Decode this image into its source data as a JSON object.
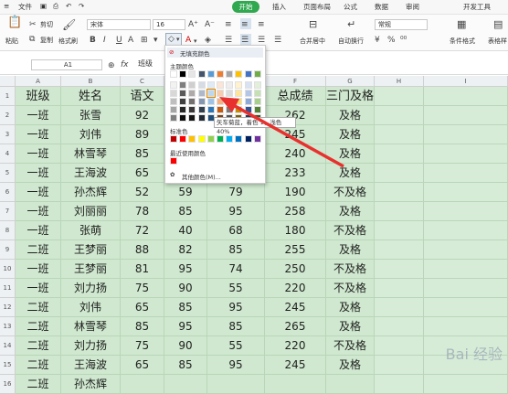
{
  "menubar": {
    "file": "文件",
    "tabs": [
      "开始",
      "插入",
      "页面布局",
      "公式",
      "数据",
      "审阅",
      "开发工具"
    ]
  },
  "ribbon": {
    "cut": "剪切",
    "copy": "复制",
    "paste": "粘贴",
    "format_painter": "格式刷",
    "font_name": "宋体",
    "font_size": "16",
    "merge_center": "合并居中",
    "wrap_text": "自动换行",
    "number_format": "常规",
    "conditional_format": "条件格式",
    "table_style": "表格样"
  },
  "formula_bar": {
    "cell_ref": "A1",
    "fx": "fx",
    "content": "班级"
  },
  "columns": [
    "A",
    "B",
    "C",
    "D",
    "E",
    "F",
    "G",
    "H",
    "I"
  ],
  "rows": [
    [
      "班级",
      "姓名",
      "语文",
      "数学",
      "英语",
      "总成绩",
      "三门及格"
    ],
    [
      "一班",
      "张雪",
      "92",
      "",
      "",
      "262",
      "及格"
    ],
    [
      "一班",
      "刘伟",
      "89",
      "",
      "",
      "245",
      "及格"
    ],
    [
      "一班",
      "林雪琴",
      "85",
      "",
      "",
      "240",
      "及格"
    ],
    [
      "一班",
      "王海波",
      "65",
      "",
      "",
      "233",
      "及格"
    ],
    [
      "一班",
      "孙杰辉",
      "52",
      "59",
      "79",
      "190",
      "不及格"
    ],
    [
      "一班",
      "刘丽丽",
      "78",
      "85",
      "95",
      "258",
      "及格"
    ],
    [
      "一班",
      "张萌",
      "72",
      "40",
      "68",
      "180",
      "不及格"
    ],
    [
      "二班",
      "王梦丽",
      "88",
      "82",
      "85",
      "255",
      "及格"
    ],
    [
      "一班",
      "王梦丽",
      "81",
      "95",
      "74",
      "250",
      "不及格"
    ],
    [
      "一班",
      "刘力扬",
      "75",
      "90",
      "55",
      "220",
      "不及格"
    ],
    [
      "二班",
      "刘伟",
      "65",
      "85",
      "95",
      "245",
      "及格"
    ],
    [
      "二班",
      "林雪琴",
      "85",
      "95",
      "85",
      "265",
      "及格"
    ],
    [
      "二班",
      "刘力扬",
      "75",
      "90",
      "55",
      "220",
      "不及格"
    ],
    [
      "二班",
      "王海波",
      "65",
      "85",
      "95",
      "245",
      "及格"
    ],
    [
      "二班",
      "孙杰辉",
      "",
      "",
      "",
      "",
      ""
    ]
  ],
  "row_numbers": [
    "1",
    "2",
    "3",
    "4",
    "5",
    "6",
    "7",
    "8",
    "9",
    "10",
    "11",
    "12",
    "13",
    "14",
    "15",
    "16"
  ],
  "palette": {
    "no_fill": "无填充颜色",
    "theme_colors": "主题颜色",
    "standard_colors": "标准色",
    "recent_colors": "最近使用颜色",
    "more_colors": "其他颜色(M)...",
    "tooltip": "矢车菊蓝，着色 1，浅色 40%",
    "theme_rows": [
      [
        "#ffffff",
        "#000000",
        "#e7e6e6",
        "#44546a",
        "#5b9bd5",
        "#ed7d31",
        "#a5a5a5",
        "#ffc000",
        "#4472c4",
        "#70ad47"
      ],
      [
        "#f2f2f2",
        "#7f7f7f",
        "#d0cece",
        "#d6dce4",
        "#deebf6",
        "#fbe5d5",
        "#ededed",
        "#fff2cc",
        "#d9e2f3",
        "#e2efd9"
      ],
      [
        "#d8d8d8",
        "#595959",
        "#aeaaaa",
        "#adb9ca",
        "#bdd7ee",
        "#f7cbac",
        "#dbdbdb",
        "#fee599",
        "#b4c6e7",
        "#c5e0b3"
      ],
      [
        "#bfbfbf",
        "#3f3f3f",
        "#757070",
        "#8496b0",
        "#9dc3e6",
        "#f4b183",
        "#c9c9c9",
        "#ffd965",
        "#8eaadb",
        "#a8d08d"
      ],
      [
        "#a5a5a5",
        "#262626",
        "#3a3838",
        "#323f4f",
        "#2e75b5",
        "#c55a11",
        "#7b7b7b",
        "#bf9000",
        "#2f5496",
        "#538135"
      ],
      [
        "#7f7f7f",
        "#0c0c0c",
        "#171616",
        "#222a35",
        "#1e4e79",
        "#833c0b",
        "#525252",
        "#7f6000",
        "#1f3864",
        "#375623"
      ]
    ],
    "standard": [
      "#c00000",
      "#ff0000",
      "#ffc000",
      "#ffff00",
      "#92d050",
      "#00b050",
      "#00b0f0",
      "#0070c0",
      "#002060",
      "#7030a0"
    ],
    "recent": [
      "#ff0000"
    ]
  },
  "colors": {
    "accent": "#2fa84f",
    "fill": "#cfe8cf",
    "arrow": "#e8312e"
  },
  "watermark": "Bai 经验"
}
